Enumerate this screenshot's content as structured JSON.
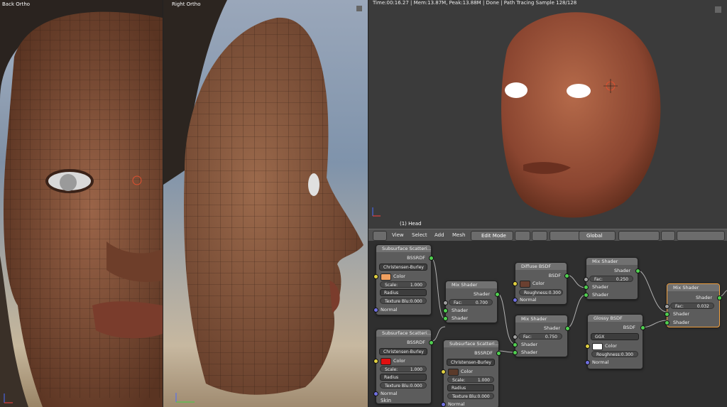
{
  "viewports": {
    "back": {
      "title": "Back Ortho"
    },
    "right": {
      "title": "Right Ortho"
    },
    "render": {
      "stats": "Time:00:16.27 | Mem:13.87M, Peak:13.88M | Done | Path Tracing Sample 128/128",
      "object_label": "(1) Head"
    }
  },
  "header": {
    "view": "View",
    "select": "Select",
    "add": "Add",
    "mesh": "Mesh",
    "mode": "Edit Mode",
    "orientation": "Global"
  },
  "nodes": {
    "sss1": {
      "title": "Subsurface Scatteri...",
      "out": "BSSRDF",
      "falloff": "Christensen-Burley",
      "color_label": "Color",
      "color": "#f0a060",
      "scale": "Scale:",
      "scale_val": "1.000",
      "radius": "Radius",
      "blur": "Texture Blu:0.000",
      "normal": "Normal"
    },
    "sss2": {
      "title": "Subsurface Scatteri...",
      "out": "BSSRDF",
      "falloff": "Christensen-Burley",
      "color_label": "Color",
      "color": "#e01010",
      "scale": "Scale:",
      "scale_val": "1.000",
      "radius": "Radius",
      "blur": "Texture Blu:0.000",
      "normal": "Normal",
      "name": "Skin"
    },
    "sss3": {
      "title": "Subsurface Scatteri...",
      "out": "BSSRDF",
      "falloff": "Christensen-Burley",
      "color_label": "Color",
      "color": "#5a3a2a",
      "scale": "Scale:",
      "scale_val": "1.000",
      "radius": "Radius",
      "blur": "Texture Blu:0.000",
      "normal": "Normal"
    },
    "mix1": {
      "title": "Mix Shader",
      "out": "Shader",
      "fac": "Fac:",
      "fac_val": "0.700",
      "in1": "Shader",
      "in2": "Shader"
    },
    "mix2": {
      "title": "Mix Shader",
      "out": "Shader",
      "fac": "Fac:",
      "fac_val": "0.750",
      "in1": "Shader",
      "in2": "Shader"
    },
    "mix3": {
      "title": "Mix Shader",
      "out": "Shader",
      "fac": "Fac:",
      "fac_val": "0.250",
      "in1": "Shader",
      "in2": "Shader"
    },
    "mix4": {
      "title": "Mix Shader",
      "out": "Shader",
      "fac": "Fac:",
      "fac_val": "0.032",
      "in1": "Shader",
      "in2": "Shader"
    },
    "diffuse": {
      "title": "Diffuse BSDF",
      "out": "BSDF",
      "color_label": "Color",
      "color": "#6a4030",
      "rough": "Roughness:0.300",
      "normal": "Normal"
    },
    "glossy": {
      "title": "Glossy BSDF",
      "out": "BSDF",
      "dist": "GGX",
      "color_label": "Color",
      "color": "#ffffff",
      "rough": "Roughness:0.300",
      "normal": "Normal"
    }
  }
}
